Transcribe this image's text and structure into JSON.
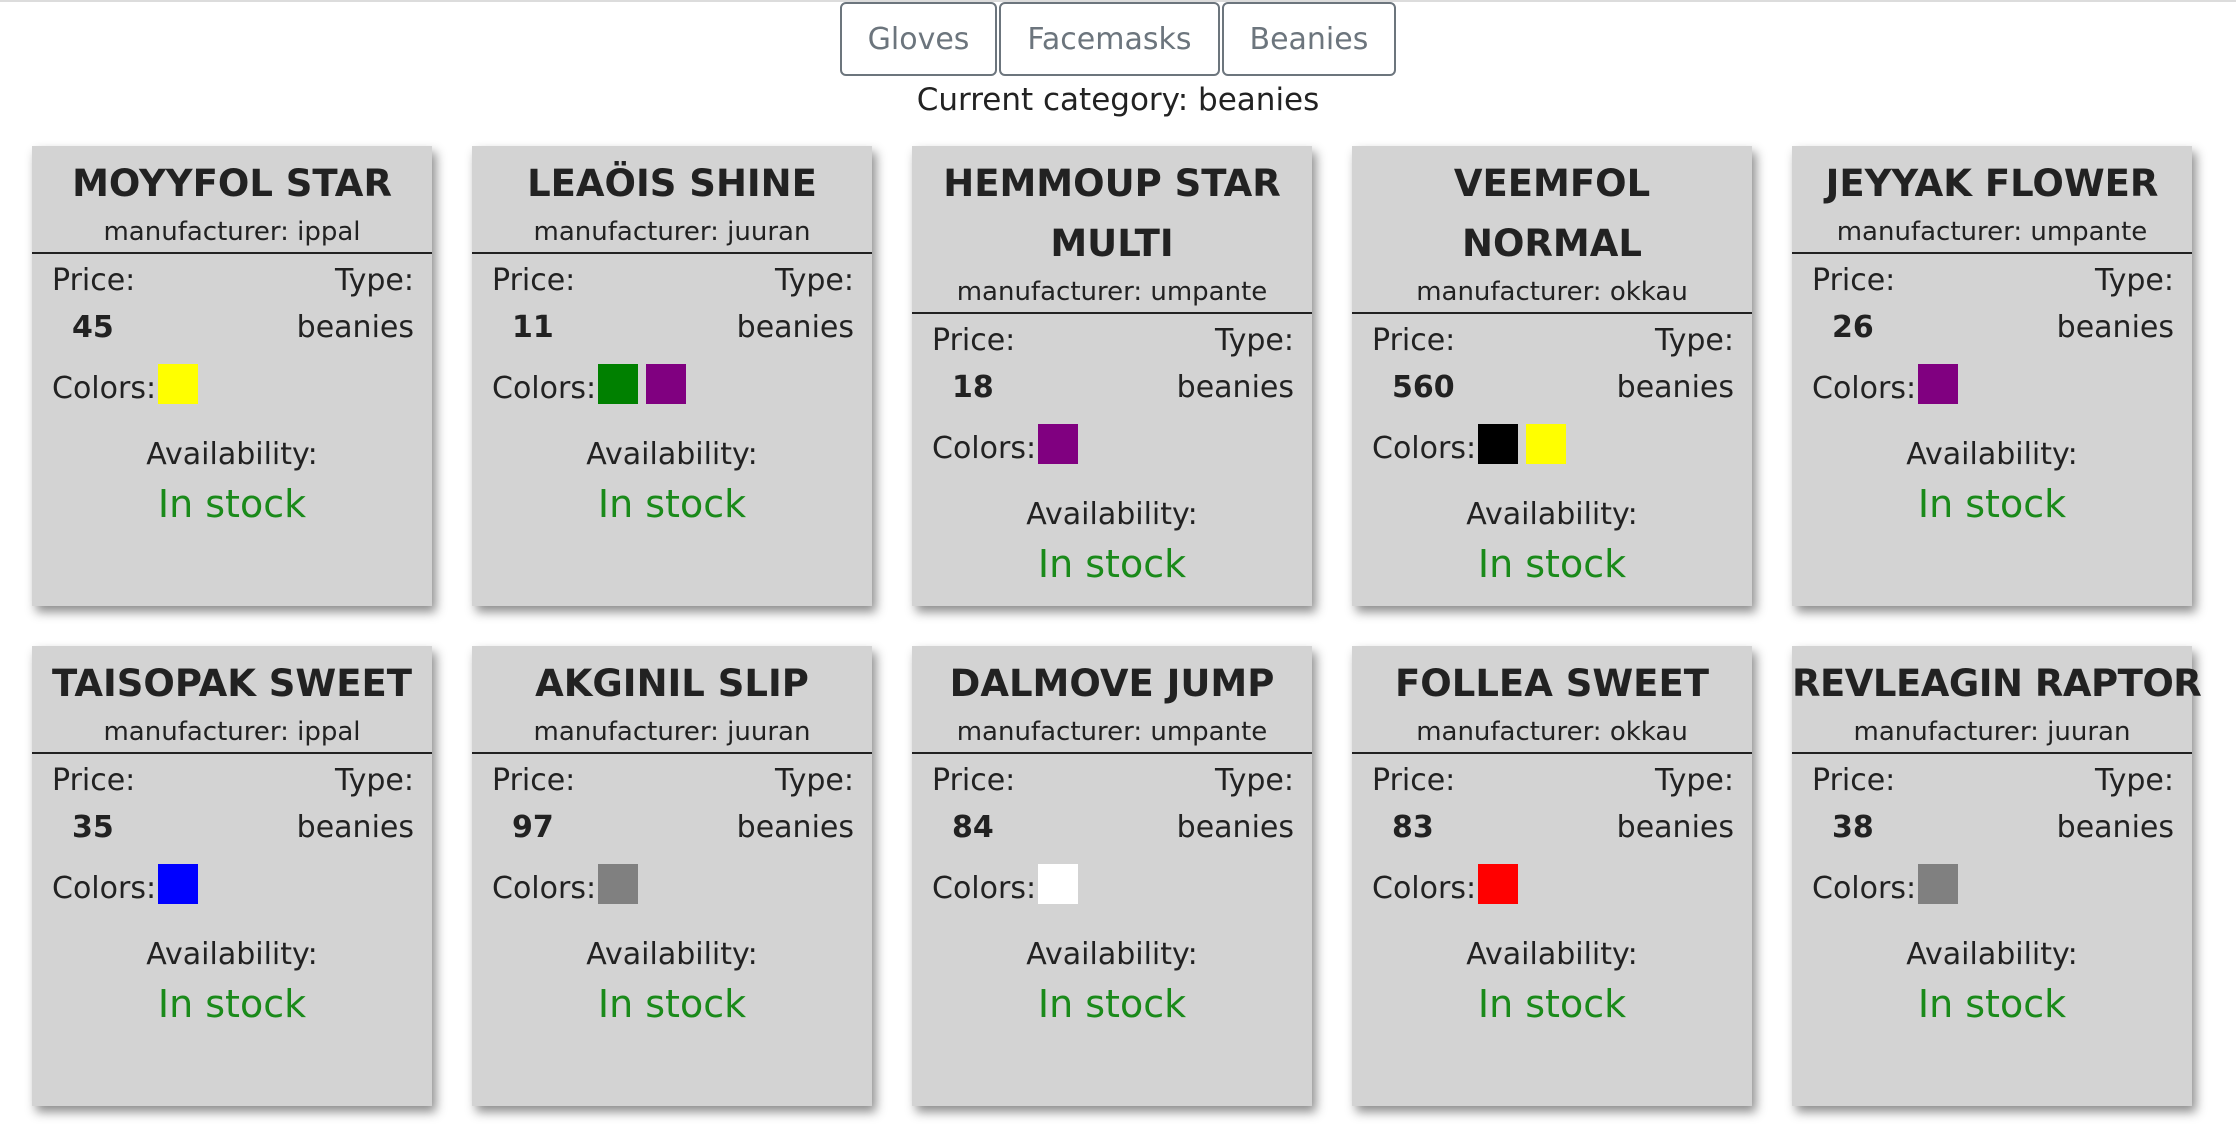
{
  "categories": [
    {
      "label": "Gloves"
    },
    {
      "label": "Facemasks"
    },
    {
      "label": "Beanies"
    }
  ],
  "current_category_text": "Current category: beanies",
  "labels": {
    "manufacturer_prefix": "manufacturer: ",
    "price": "Price:",
    "type": "Type:",
    "colors": "Colors:",
    "availability": "Availability:"
  },
  "products": [
    {
      "name": "MOYYFOL STAR",
      "manufacturer": "manufacturer: ippal",
      "price": "45",
      "type": "beanies",
      "colors": [
        "#ffff00"
      ],
      "availability": "In stock"
    },
    {
      "name": "LEAÖIS SHINE",
      "manufacturer": "manufacturer: juuran",
      "price": "11",
      "type": "beanies",
      "colors": [
        "#008000",
        "#800080"
      ],
      "availability": "In stock"
    },
    {
      "name": "HEMMOUP STAR MULTI",
      "manufacturer": "manufacturer: umpante",
      "price": "18",
      "type": "beanies",
      "colors": [
        "#800080"
      ],
      "availability": "In stock"
    },
    {
      "name": "VEEMFOL NORMAL",
      "manufacturer": "manufacturer: okkau",
      "price": "560",
      "type": "beanies",
      "colors": [
        "#000000",
        "#ffff00"
      ],
      "availability": "In stock"
    },
    {
      "name": "JEYYAK FLOWER",
      "manufacturer": "manufacturer: umpante",
      "price": "26",
      "type": "beanies",
      "colors": [
        "#800080"
      ],
      "availability": "In stock"
    },
    {
      "name": "TAISOPAK SWEET",
      "manufacturer": "manufacturer: ippal",
      "price": "35",
      "type": "beanies",
      "colors": [
        "#0000ff"
      ],
      "availability": "In stock"
    },
    {
      "name": "AKGINIL SLIP",
      "manufacturer": "manufacturer: juuran",
      "price": "97",
      "type": "beanies",
      "colors": [
        "#808080"
      ],
      "availability": "In stock"
    },
    {
      "name": "DALMOVE JUMP",
      "manufacturer": "manufacturer: umpante",
      "price": "84",
      "type": "beanies",
      "colors": [
        "#ffffff"
      ],
      "availability": "In stock"
    },
    {
      "name": "FOLLEA SWEET",
      "manufacturer": "manufacturer: okkau",
      "price": "83",
      "type": "beanies",
      "colors": [
        "#ff0000"
      ],
      "availability": "In stock"
    },
    {
      "name": "REVLEAGIN RAPTOR",
      "manufacturer": "manufacturer: juuran",
      "price": "38",
      "type": "beanies",
      "colors": [
        "#808080"
      ],
      "availability": "In stock"
    }
  ],
  "theme": {
    "card_bg": "#d3d3d3",
    "in_stock_color": "#1a8a1a",
    "button_color": "#6c757d"
  }
}
